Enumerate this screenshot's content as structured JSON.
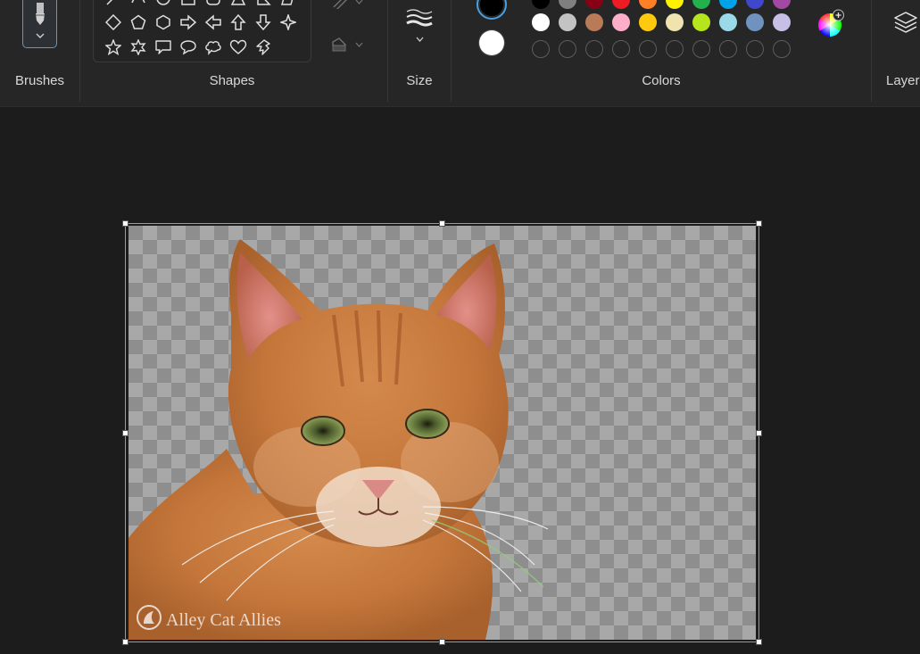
{
  "ribbon": {
    "brushes": {
      "label": "Brushes",
      "icon": "brush-icon"
    },
    "shapes": {
      "label": "Shapes",
      "rows": [
        [
          "line",
          "curve",
          "oval",
          "rectangle",
          "rounded-rectangle",
          "triangle",
          "right-triangle",
          "parallelogram"
        ],
        [
          "diamond",
          "pentagon",
          "hexagon",
          "arrow-right",
          "arrow-left",
          "arrow-up",
          "arrow-down",
          "star-four"
        ],
        [
          "star-five",
          "star-six",
          "callout-rect",
          "callout-oval",
          "callout-cloud",
          "heart",
          "lightning"
        ]
      ],
      "outline_icon": "pencil-outline-icon",
      "fill_icon": "paint-fill-icon"
    },
    "size": {
      "label": "Size",
      "icon": "line-thickness-icon"
    },
    "colors": {
      "label": "Colors",
      "primary": "#000000",
      "secondary": "#ffffff",
      "row1": [
        "#000000",
        "#7f7f7f",
        "#880015",
        "#ed1c24",
        "#ff7f27",
        "#fff200",
        "#22b14c",
        "#00a2e8",
        "#3f48cc",
        "#a349a4"
      ],
      "row2": [
        "#ffffff",
        "#c3c3c3",
        "#b97a57",
        "#ffaec9",
        "#ffc90e",
        "#efe4b0",
        "#b5e61d",
        "#99d9ea",
        "#7092be",
        "#c8bfe7"
      ],
      "custom_count": 10,
      "picker_icon": "color-wheel-icon"
    },
    "layers": {
      "label": "Layer",
      "icon": "layers-icon"
    }
  },
  "canvas": {
    "watermark": "Alley Cat Allies"
  }
}
